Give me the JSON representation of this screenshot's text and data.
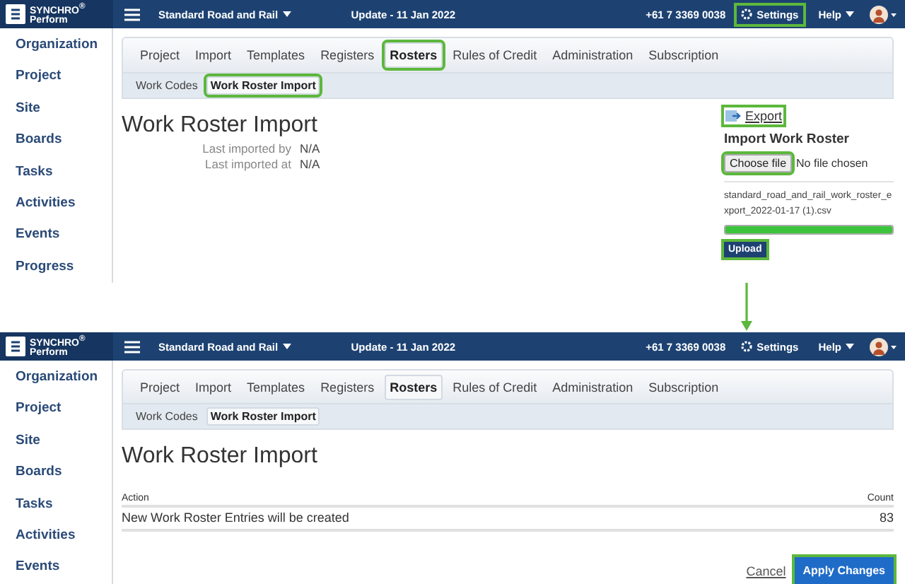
{
  "screens": [
    {
      "header": {
        "brand": "SYNCHRO$^{®}$",
        "product": "Perform",
        "project": "Standard Road and Rail",
        "update": "Update - 11 Jan 2022",
        "phone": "+61 7 3369 0038",
        "settings": {
          "label": "Settings",
          "highlighted": true
        },
        "help": "Help"
      },
      "sidebar": [
        "Organization",
        "Project",
        "Site",
        "Boards",
        "Tasks",
        "Activities",
        "Events",
        "Progress"
      ],
      "tabs": [
        {
          "label": "Project",
          "selected": false,
          "highlighted": false
        },
        {
          "label": "Import",
          "selected": false,
          "highlighted": false
        },
        {
          "label": "Templates",
          "selected": false,
          "highlighted": false
        },
        {
          "label": "Registers",
          "selected": false,
          "highlighted": false
        },
        {
          "label": "Rosters",
          "selected": true,
          "highlighted": true
        },
        {
          "label": "Rules of Credit",
          "selected": false,
          "highlighted": false
        },
        {
          "label": "Administration",
          "selected": false,
          "highlighted": false
        },
        {
          "label": "Subscription",
          "selected": false,
          "highlighted": false
        }
      ],
      "subtabs": [
        {
          "label": "Work Codes",
          "selected": false,
          "highlighted": false
        },
        {
          "label": "Work Roster Import",
          "selected": true,
          "highlighted": true
        }
      ],
      "title": "Work Roster Import",
      "info": [
        {
          "label": "Last imported by",
          "value": "N/A"
        },
        {
          "label": "Last imported at",
          "value": "N/A"
        }
      ],
      "import_panel": {
        "export": {
          "label": "Export",
          "highlighted": true
        },
        "heading": "Import Work Roster",
        "choose": {
          "label": "Choose file",
          "highlighted": true
        },
        "file_status": "No file chosen",
        "filename": "standard_road_and_rail_work_roster_export_2022-01-17 (1).csv",
        "level": 1,
        "upload": {
          "label": "Upload",
          "highlighted": true
        }
      }
    },
    {
      "header": {
        "brand": "SYNCHRO$^{®}$",
        "product": "Perform",
        "project": "Standard Road and Rail",
        "update": "Update - 11 Jan 2022",
        "phone": "+61 7 3369 0038",
        "settings": {
          "label": "Settings",
          "highlighted": false
        },
        "help": "Help"
      },
      "sidebar": [
        "Organization",
        "Project",
        "Site",
        "Boards",
        "Tasks",
        "Activities",
        "Events"
      ],
      "tabs": [
        {
          "label": "Project",
          "selected": false,
          "highlighted": false
        },
        {
          "label": "Import",
          "selected": false,
          "highlighted": false
        },
        {
          "label": "Templates",
          "selected": false,
          "highlighted": false
        },
        {
          "label": "Registers",
          "selected": false,
          "highlighted": false
        },
        {
          "label": "Rosters",
          "selected": true,
          "highlighted": false
        },
        {
          "label": "Rules of Credit",
          "selected": false,
          "highlighted": false
        },
        {
          "label": "Administration",
          "selected": false,
          "highlighted": false
        },
        {
          "label": "Subscription",
          "selected": false,
          "highlighted": false
        }
      ],
      "subtabs": [
        {
          "label": "Work Codes",
          "selected": false,
          "highlighted": false
        },
        {
          "label": "Work Roster Import",
          "selected": true,
          "highlighted": false
        }
      ],
      "title": "Work Roster Import",
      "table": {
        "columns": [
          "Action",
          "Count"
        ],
        "rows": [
          [
            "New Work Roster Entries will be created",
            "83"
          ]
        ]
      },
      "actions": {
        "cancel": "Cancel",
        "apply": {
          "label": "Apply Changes",
          "highlighted": true
        }
      }
    }
  ]
}
